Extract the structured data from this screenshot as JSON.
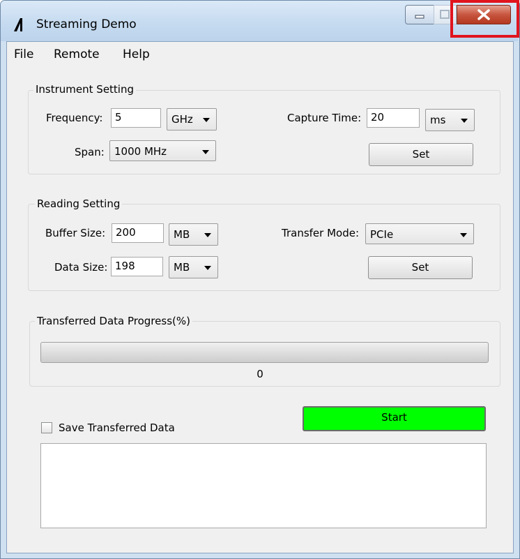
{
  "window": {
    "title": "Streaming Demo",
    "icons": [
      "app-logo-icon",
      "minimize-icon",
      "maximize-icon",
      "close-icon"
    ],
    "highlight_color": "#e1141e"
  },
  "menu": {
    "file": "File",
    "remote": "Remote",
    "help": "Help"
  },
  "instrument": {
    "title": "Instrument Setting",
    "frequency_label": "Frequency:",
    "frequency_value": "5",
    "frequency_unit": "GHz",
    "span_label": "Span:",
    "span_value": "1000 MHz",
    "capture_label": "Capture Time:",
    "capture_value": "20",
    "capture_unit": "ms",
    "set_label": "Set"
  },
  "reading": {
    "title": "Reading Setting",
    "buffer_label": "Buffer Size:",
    "buffer_value": "200",
    "buffer_unit": "MB",
    "data_label": "Data Size:",
    "data_value": "198",
    "data_unit": "MB",
    "transfer_label": "Transfer Mode:",
    "transfer_value": "PCIe",
    "set_label": "Set"
  },
  "progress": {
    "title": "Transferred Data Progress(%)",
    "value_text": "0",
    "value": 0
  },
  "bottom": {
    "save_label": "Save Transferred Data",
    "save_checked": false,
    "start_label": "Start",
    "start_color": "#00ff00",
    "output_text": ""
  }
}
